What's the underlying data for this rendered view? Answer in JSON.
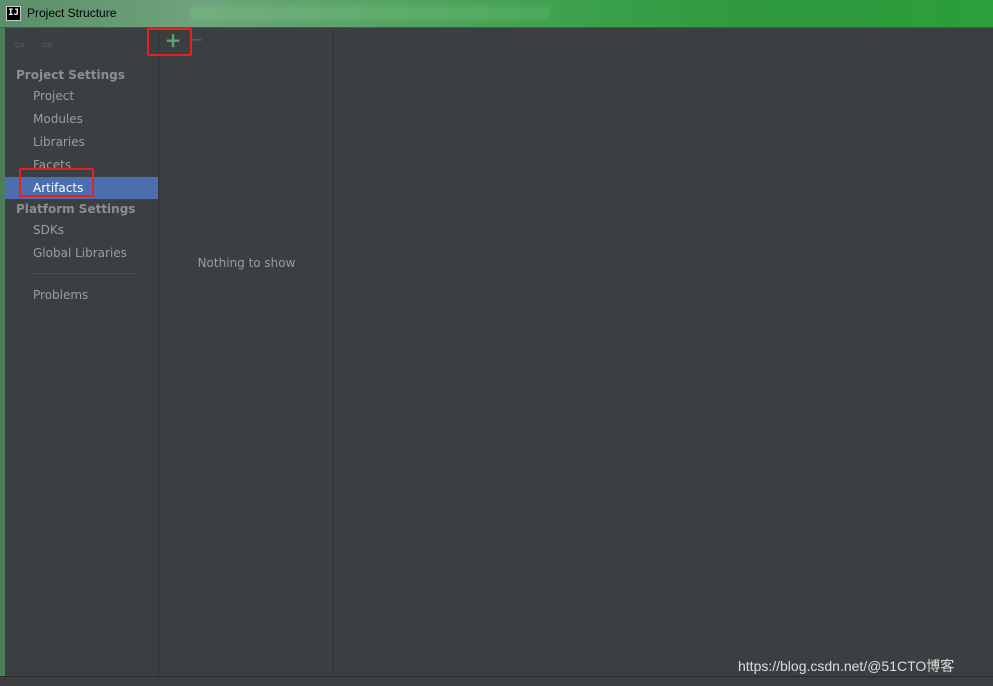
{
  "window": {
    "title": "Project Structure",
    "app_icon": "IJ"
  },
  "sidebar": {
    "nav_back_icon": "arrow-left-icon",
    "nav_forward_icon": "arrow-right-icon",
    "sections": [
      {
        "header": "Project Settings",
        "items": [
          "Project",
          "Modules",
          "Libraries",
          "Facets",
          "Artifacts"
        ]
      },
      {
        "header": "Platform Settings",
        "items": [
          "SDKs",
          "Global Libraries"
        ]
      }
    ],
    "problems_label": "Problems",
    "selected_item": "Artifacts"
  },
  "list_panel": {
    "add_icon": "plus-icon",
    "remove_icon": "minus-icon",
    "empty_text": "Nothing to show"
  },
  "watermark": "https://blog.csdn.net/@51CTO博客",
  "colors": {
    "panel_bg": "#3c3f41",
    "selection": "#4b6eaf",
    "add_green": "#59a869",
    "highlight_red": "#e8201e"
  }
}
